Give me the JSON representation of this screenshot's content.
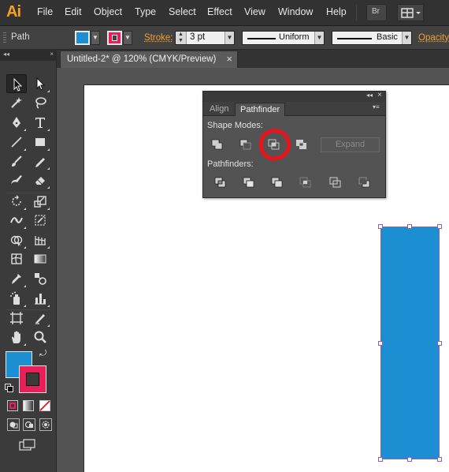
{
  "app": {
    "logo": "Ai",
    "menu": [
      "File",
      "Edit",
      "Object",
      "Type",
      "Select",
      "Effect",
      "View",
      "Window",
      "Help"
    ],
    "bridge_button": "Br"
  },
  "control_bar": {
    "selection_label": "Path",
    "fill_color": "#1b8fd2",
    "stroke_color": "#ea1f5a",
    "stroke_label": "Stroke:",
    "stroke_weight": "3 pt",
    "variable_width_profile": "Uniform",
    "brush_definition": "Basic",
    "opacity_label": "Opacity:"
  },
  "document": {
    "tab_title": "Untitled-2* @ 120% (CMYK/Preview)",
    "tab_close": "×"
  },
  "tools_panel": {
    "collapse_glyph": "◂◂",
    "close_glyph": "×",
    "fill_color": "#1b8fd2",
    "stroke_color": "#ea1f5a"
  },
  "pathfinder_panel": {
    "tabs": [
      "Align",
      "Pathfinder"
    ],
    "active_tab": "Pathfinder",
    "shape_modes_label": "Shape Modes:",
    "pathfinders_label": "Pathfinders:",
    "expand_label": "Expand",
    "highlighted_button": "intersect",
    "annotation_color": "#e8141b"
  },
  "artwork": {
    "shape": "rectangle",
    "fill": "#1b8fd2",
    "selection_color": "#8a5fb9"
  }
}
